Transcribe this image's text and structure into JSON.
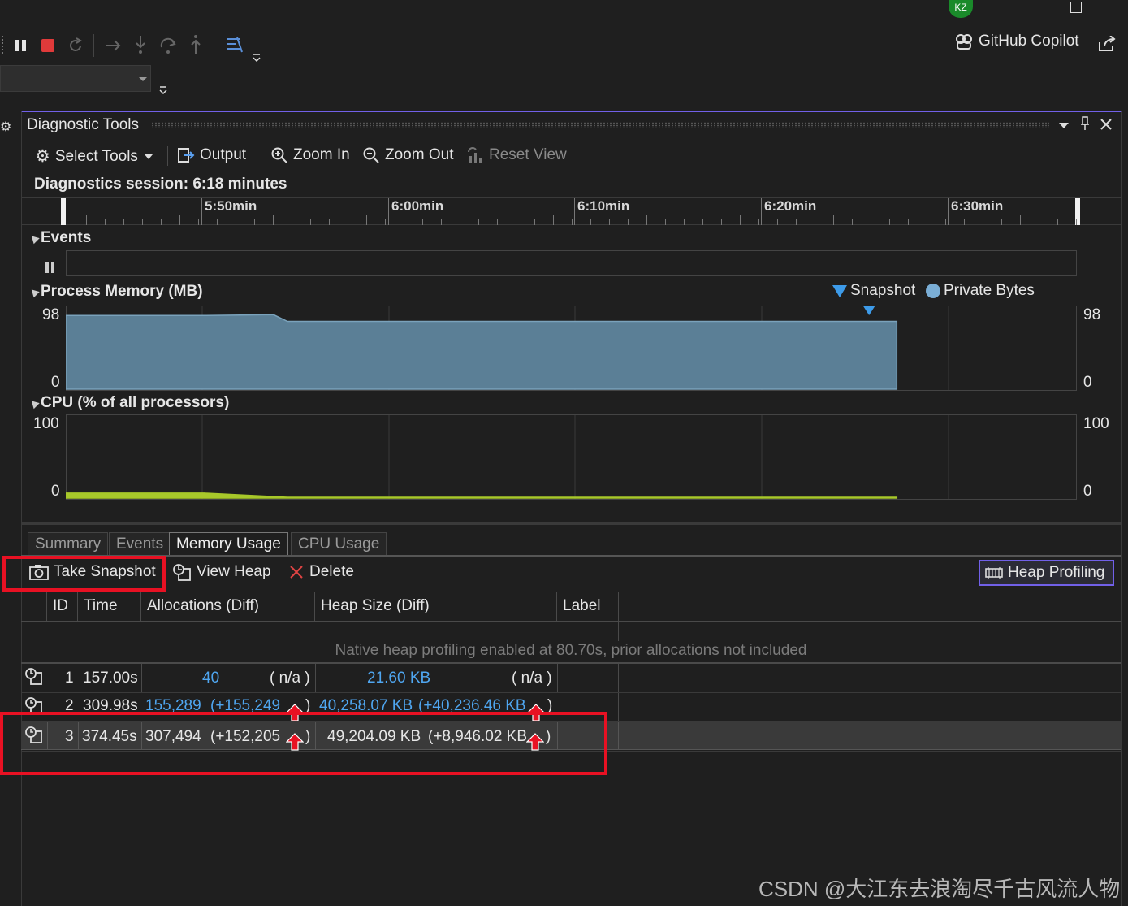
{
  "window": {
    "avatar": "KZ",
    "copilot": "GitHub Copilot"
  },
  "panel": {
    "title": "Diagnostic Tools"
  },
  "toolbar": {
    "select_tools": "Select Tools",
    "output": "Output",
    "zoom_in": "Zoom In",
    "zoom_out": "Zoom Out",
    "reset_view": "Reset View"
  },
  "session": {
    "label": "Diagnostics session: 6:18 minutes"
  },
  "ruler": {
    "ticks": [
      "5:50min",
      "6:00min",
      "6:10min",
      "6:20min",
      "6:30min"
    ]
  },
  "events": {
    "title": "Events"
  },
  "memory": {
    "title": "Process Memory (MB)",
    "legend_snapshot": "Snapshot",
    "legend_private": "Private Bytes",
    "y_max": "98",
    "y_min": "0",
    "y_max_right": "98",
    "y_min_right": "0"
  },
  "cpu": {
    "title": "CPU (% of all processors)",
    "y_max": "100",
    "y_min": "0",
    "y_max_right": "100",
    "y_min_right": "0"
  },
  "tabs": [
    {
      "label": "Summary"
    },
    {
      "label": "Events"
    },
    {
      "label": "Memory Usage"
    },
    {
      "label": "CPU Usage"
    }
  ],
  "actions": {
    "take_snapshot": "Take Snapshot",
    "view_heap": "View Heap",
    "delete": "Delete",
    "heap_profiling": "Heap Profiling"
  },
  "table": {
    "headers": [
      "ID",
      "Time",
      "Allocations (Diff)",
      "Heap Size (Diff)",
      "Label"
    ],
    "notice": "Native heap profiling enabled at 80.70s, prior allocations not included",
    "rows": [
      {
        "id": "1",
        "time": "157.00s",
        "alloc": "40",
        "alloc_diff": "( n/a )",
        "heap": "21.60 KB",
        "heap_diff": "( n/a )"
      },
      {
        "id": "2",
        "time": "309.98s",
        "alloc": "155,289",
        "alloc_diff": "(+155,249",
        "heap": "40,258.07 KB",
        "heap_diff": "(+40,236.46 KB"
      },
      {
        "id": "3",
        "time": "374.45s",
        "alloc": "307,494",
        "alloc_diff": "(+152,205",
        "heap": "49,204.09 KB",
        "heap_diff": "(+8,946.02 KB"
      }
    ],
    "close_paren": ")"
  },
  "watermark": "CSDN @大江东去浪淘尽千古风流人物",
  "colors": {
    "accent": "#7160e8",
    "memory_fill": "#5b7f96",
    "cpu_line": "#a8c82a",
    "highlight": "#e81123",
    "link": "#4fa6f0"
  },
  "chart_data": [
    {
      "type": "area",
      "title": "Process Memory (MB)",
      "x_range_min": [
        5.8,
        6.53
      ],
      "ylim": [
        0,
        98
      ],
      "series": [
        {
          "name": "Private Bytes",
          "x": [
            5.8,
            5.9,
            5.95,
            5.96,
            6.4
          ],
          "values": [
            88,
            88,
            89,
            81,
            81
          ]
        }
      ],
      "snapshots_min": [
        6.38
      ]
    },
    {
      "type": "area",
      "title": "CPU (% of all processors)",
      "x_range_min": [
        5.8,
        6.53
      ],
      "ylim": [
        0,
        100
      ],
      "series": [
        {
          "name": "CPU",
          "x": [
            5.8,
            5.9,
            5.96,
            6.4
          ],
          "values": [
            6,
            6,
            1,
            1
          ]
        }
      ]
    }
  ]
}
